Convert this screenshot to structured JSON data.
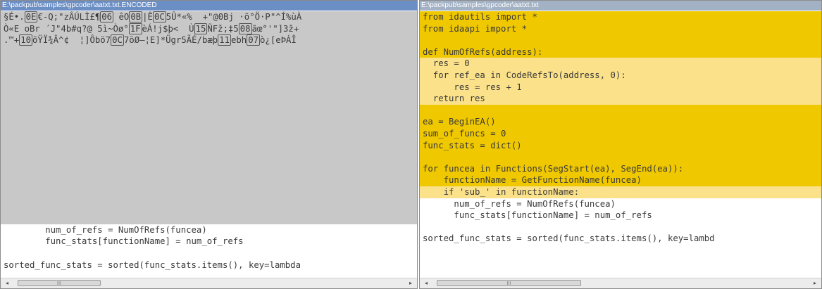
{
  "left_pane": {
    "title": "E:\\packpub\\samples\\gpcoder\\aatxt.txt.ENCODED",
    "encoded_lines": [
      [
        {
          "t": "§É•."
        },
        {
          "t": "0E",
          "box": true
        },
        {
          "t": "€-Q;\"zÂÚLÌ£¶"
        },
        {
          "t": "06",
          "box": true
        },
        {
          "t": " êO"
        },
        {
          "t": "0B",
          "box": true
        },
        {
          "t": "|Ê"
        },
        {
          "t": "0C",
          "box": true
        },
        {
          "t": "5Û*«%  +\"@0Bj ·õ°Ö·P\"^Í%ùÀ"
        }
      ],
      [
        {
          "t": "Ò«E oBr ´J\"4b#q?@ 5ì~Òø°"
        },
        {
          "t": "1F",
          "box": true
        },
        {
          "t": "èÁ!j$þ<  Ù"
        },
        {
          "t": "15",
          "box": true
        },
        {
          "t": "ÑFž;‡5"
        },
        {
          "t": "08",
          "box": true
        },
        {
          "t": "ãœ°'\"]3ž+"
        }
      ],
      [
        {
          "t": ".™+"
        },
        {
          "t": "10",
          "box": true
        },
        {
          "t": "õŸÏ¾Â^¢  ¦]Ôbö7"
        },
        {
          "t": "0C",
          "box": true
        },
        {
          "t": "7öØ—¦E]*Ügr5ÃÉ/bæþ"
        },
        {
          "t": "11",
          "box": true
        },
        {
          "t": "ebh"
        },
        {
          "t": "07",
          "box": true
        },
        {
          "t": "ò¿[eÞÁÎ"
        }
      ]
    ],
    "code_lines": [
      "        num_of_refs = NumOfRefs(funcea)",
      "        func_stats[functionName] = num_of_refs",
      "",
      "sorted_func_stats = sorted(func_stats.items(), key=lambda"
    ],
    "scrollbar_grip": "III",
    "scroll_left_label": "◂",
    "scroll_right_label": "▸"
  },
  "right_pane": {
    "title": "E:\\packpub\\samples\\gpcoder\\aatxt.txt",
    "highlighted_lines": [
      {
        "text": "from idautils import *",
        "style": "hl"
      },
      {
        "text": "from idaapi import *",
        "style": "hl"
      },
      {
        "text": "",
        "style": "hl"
      },
      {
        "text": "def NumOfRefs(address):",
        "style": "hl"
      },
      {
        "text": "  res = 0",
        "style": "hl-soft"
      },
      {
        "text": "  for ref_ea in CodeRefsTo(address, 0):",
        "style": "hl-soft"
      },
      {
        "text": "      res = res + 1",
        "style": "hl-soft"
      },
      {
        "text": "  return res",
        "style": "hl-soft"
      },
      {
        "text": "",
        "style": "hl"
      },
      {
        "text": "ea = BeginEA()",
        "style": "hl"
      },
      {
        "text": "sum_of_funcs = 0",
        "style": "hl"
      },
      {
        "text": "func_stats = dict()",
        "style": "hl"
      },
      {
        "text": "",
        "style": "hl"
      },
      {
        "text": "for funcea in Functions(SegStart(ea), SegEnd(ea)):",
        "style": "hl"
      },
      {
        "text": "    functionName = GetFunctionName(funcea)",
        "style": "hl"
      },
      {
        "text": "    if 'sub_' in functionName:",
        "style": "hl-soft"
      }
    ],
    "code_lines": [
      "      num_of_refs = NumOfRefs(funcea)",
      "      func_stats[functionName] = num_of_refs",
      "",
      "sorted_func_stats = sorted(func_stats.items(), key=lambd"
    ],
    "scrollbar_grip": "III",
    "scroll_left_label": "◂",
    "scroll_right_label": "▸"
  },
  "colors": {
    "highlight": "#f0c800",
    "highlight_soft": "#fae18a",
    "encoded_background": "#c8c8c8"
  }
}
